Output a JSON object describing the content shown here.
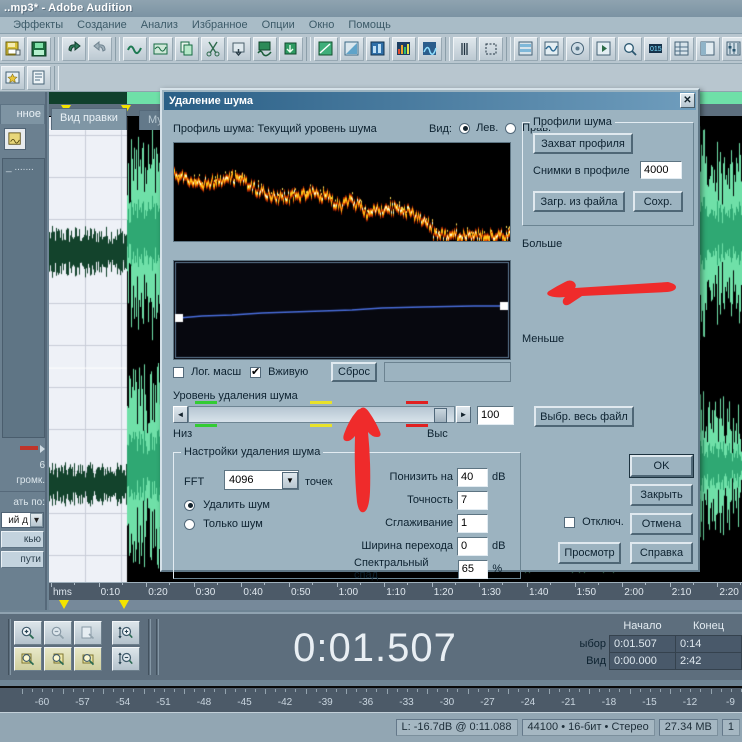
{
  "app": {
    "title": "..mp3* - Adobe Audition",
    "menu": [
      "а",
      "Эффекты",
      "Создание",
      "Анализ",
      "Избранное",
      "Опции",
      "Окно",
      "Помощь"
    ]
  },
  "sidebar": {
    "tab_label": "нное",
    "list_text": "_ .......",
    "meter_value": "6",
    "volume_label": "громк.",
    "sort_label": "ать по:",
    "combo_value": "ий д",
    "buttons": [
      "кью",
      "пути"
    ]
  },
  "editor": {
    "tabs": [
      {
        "label": "Вид правки",
        "active": true
      },
      {
        "label": "Муль",
        "active": false
      }
    ],
    "ruler_ticks": [
      "hms",
      "0:10",
      "0:20",
      "0:30",
      "0:40",
      "0:50",
      "1:00",
      "1:10",
      "1:20",
      "1:30",
      "1:40",
      "1:50",
      "2:00",
      "2:10",
      "2:20"
    ],
    "db_ticks": [
      "-60",
      "-57",
      "-54",
      "-51",
      "-48",
      "-45",
      "-42",
      "-39",
      "-36",
      "-33",
      "-30",
      "-27",
      "-24",
      "-21",
      "-18",
      "-15",
      "-12",
      "-9"
    ]
  },
  "transport": {
    "big_time": "0:01.507",
    "headers": [
      "Начало",
      "Конец"
    ],
    "rows": [
      {
        "label": "ыбор",
        "start": "0:01.507",
        "end": "0:14"
      },
      {
        "label": "Вид",
        "start": "0:00.000",
        "end": "2:42"
      }
    ],
    "zoom_icons": [
      "zoom-in-icon",
      "zoom-out-icon",
      "zoom-full-icon",
      "zoom-in-vertical-icon",
      "zoom-sel-left-icon",
      "zoom-sel-right-icon",
      "zoom-sel-icon",
      "zoom-out-vertical-icon"
    ]
  },
  "statusbar": {
    "level": "L: -16.7dB @  0:11.088",
    "format": "44100 • 16-бит • Стерео",
    "size": "27.34 MB",
    "extra": "1"
  },
  "dialog": {
    "title": "Удаление шума",
    "close_label": "✕",
    "profile_label": "Профиль шума: Текущий уровень шума",
    "view_label": "Вид:",
    "view_options": [
      {
        "label": "Лев.",
        "selected": true
      },
      {
        "label": "Прав.",
        "selected": false
      }
    ],
    "profiles_group": {
      "caption": "Профили шума",
      "capture_button": "Захват профиля",
      "snapshots_label": "Снимки в профиле",
      "snapshots_value": "4000",
      "load_button": "Загр. из файла",
      "save_button": "Сохр."
    },
    "scale_more": "Больше",
    "scale_less": "Меньше",
    "log_scale_label": "Лог. масш",
    "log_scale_checked": false,
    "live_label": "Вживую",
    "live_checked": true,
    "reset_button": "Сброс",
    "status_field": "",
    "level_group_label": "Уровень удаления шума",
    "level_value": "100",
    "level_low": "Низ",
    "level_high": "Выс",
    "select_all_button": "Выбр. весь файл",
    "settings_group": {
      "caption": "Настройки удаления шума",
      "fft_label": "FFT",
      "fft_value": "4096",
      "fft_suffix": "точек",
      "mode_options": [
        {
          "label": "Удалить шум",
          "selected": true
        },
        {
          "label": "Только шум",
          "selected": false
        }
      ],
      "fields": [
        {
          "label": "Понизить на",
          "value": "40",
          "unit": "dB"
        },
        {
          "label": "Точность",
          "value": "7",
          "unit": ""
        },
        {
          "label": "Сглаживание",
          "value": "1",
          "unit": ""
        },
        {
          "label": "Ширина перехода",
          "value": "0",
          "unit": "dB"
        },
        {
          "label": "Спектральный спад",
          "value": "65",
          "unit": "%"
        }
      ]
    },
    "disable_label": "Отключ.",
    "disable_checked": false,
    "preview_button": "Просмотр",
    "actions": [
      "OK",
      "Закрыть",
      "Отмена",
      "Справка"
    ]
  },
  "colors": {
    "dialog_bg": "#9cb3c0",
    "title_accent": "#2a5f86",
    "annotation_red": "#ef2b2b",
    "waveform_green": "#6fe0a8",
    "spectrum_orange": "#ff8c00"
  }
}
